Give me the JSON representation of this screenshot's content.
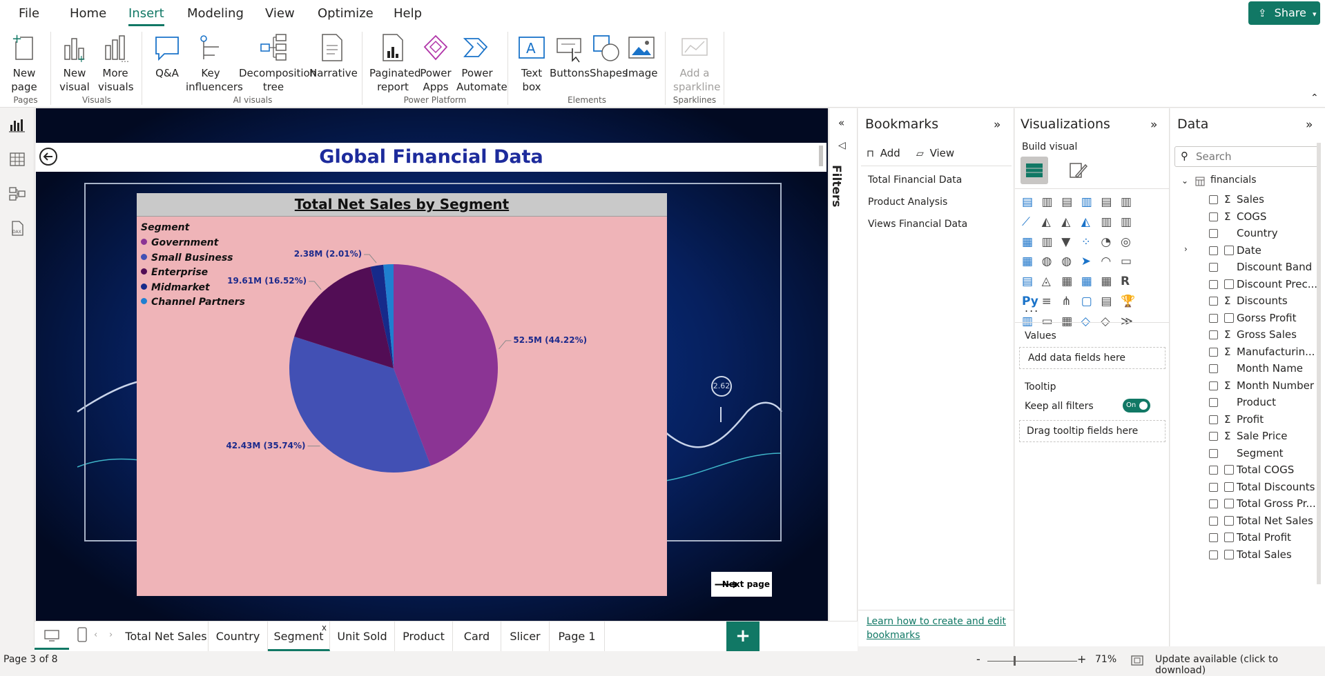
{
  "menu": {
    "items": [
      "File",
      "Home",
      "Insert",
      "Modeling",
      "View",
      "Optimize",
      "Help"
    ],
    "share": "Share"
  },
  "ribbon": {
    "buttons": {
      "new_page": "New page",
      "new_visual": "New visual",
      "more_visuals": "More visuals",
      "qa": "Q&A",
      "key_influencers": "Key influencers",
      "decomposition_tree": "Decomposition tree",
      "narrative": "Narrative",
      "paginated_report": "Paginated report",
      "power_apps": "Power Apps",
      "power_automate": "Power Automate",
      "text_box": "Text box",
      "buttons": "Buttons",
      "shapes": "Shapes",
      "image": "Image",
      "add_sparkline": "Add a sparkline"
    },
    "groups": {
      "pages": "Pages",
      "visuals": "Visuals",
      "ai_visuals": "AI visuals",
      "power_platform": "Power Platform",
      "elements": "Elements",
      "sparklines": "Sparklines"
    }
  },
  "report": {
    "title": "Global Financial Data",
    "next_page": "Next page",
    "indicator_value": "2.62"
  },
  "chart_data": {
    "type": "pie",
    "title": "Total Net Sales by Segment",
    "legend_title": "Segment",
    "legend_position": "top-left",
    "categories": [
      "Government",
      "Small Business",
      "Enterprise",
      "Midmarket",
      "Channel Partners"
    ],
    "values": [
      52.5,
      42.43,
      19.61,
      2.38,
      1.86
    ],
    "value_unit": "M",
    "data_labels": [
      "52.5M (44.22%)",
      "42.43M (35.74%)",
      "19.61M (16.52%)",
      "2.38M (2.01%)"
    ],
    "colors": [
      "#8b3494",
      "#4250b4",
      "#520d55",
      "#162a8a",
      "#1f7fd0"
    ]
  },
  "filters": {
    "label": "Filters"
  },
  "bookmarks": {
    "title": "Bookmarks",
    "add": "Add",
    "view": "View",
    "items": [
      "Total Financial Data",
      "Product Analysis",
      "Views Financial Data"
    ],
    "learn_link": "Learn how to create and edit bookmarks"
  },
  "visualizations": {
    "title": "Visualizations",
    "build_visual": "Build visual",
    "more": "...",
    "values_label": "Values",
    "values_placeholder": "Add data fields here",
    "tooltip_label": "Tooltip",
    "keep_all_filters": "Keep all filters",
    "toggle": "On",
    "tooltip_placeholder": "Drag tooltip fields here"
  },
  "data_pane": {
    "title": "Data",
    "search_placeholder": "Search",
    "table": "financials",
    "fields": [
      {
        "name": "Sales",
        "kind": "sum"
      },
      {
        "name": "COGS",
        "kind": "sum"
      },
      {
        "name": "Country",
        "kind": "text"
      },
      {
        "name": "Date",
        "kind": "date"
      },
      {
        "name": "Discount Band",
        "kind": "text"
      },
      {
        "name": "Discount Prec...",
        "kind": "calc"
      },
      {
        "name": "Discounts",
        "kind": "sum"
      },
      {
        "name": "Gorss Profit",
        "kind": "calc"
      },
      {
        "name": "Gross Sales",
        "kind": "sum"
      },
      {
        "name": "Manufacturin...",
        "kind": "sum"
      },
      {
        "name": "Month Name",
        "kind": "text"
      },
      {
        "name": "Month Number",
        "kind": "sum"
      },
      {
        "name": "Product",
        "kind": "text"
      },
      {
        "name": "Profit",
        "kind": "sum"
      },
      {
        "name": "Sale Price",
        "kind": "sum"
      },
      {
        "name": "Segment",
        "kind": "text"
      },
      {
        "name": "Total COGS",
        "kind": "measure"
      },
      {
        "name": "Total Discounts",
        "kind": "measure"
      },
      {
        "name": "Total Gross Pr...",
        "kind": "measure"
      },
      {
        "name": "Total Net Sales",
        "kind": "measure"
      },
      {
        "name": "Total Profit",
        "kind": "measure"
      },
      {
        "name": "Total Sales",
        "kind": "calc"
      }
    ]
  },
  "tabs": [
    "Total Net Sales",
    "Country",
    "Segment",
    "Unit Sold",
    "Product",
    "Card",
    "Slicer",
    "Page 1"
  ],
  "active_tab": "Segment",
  "active_tab_close": "x",
  "status": {
    "page": "Page 3 of 8",
    "zoom": "71%",
    "update": "Update available (click to download)"
  }
}
